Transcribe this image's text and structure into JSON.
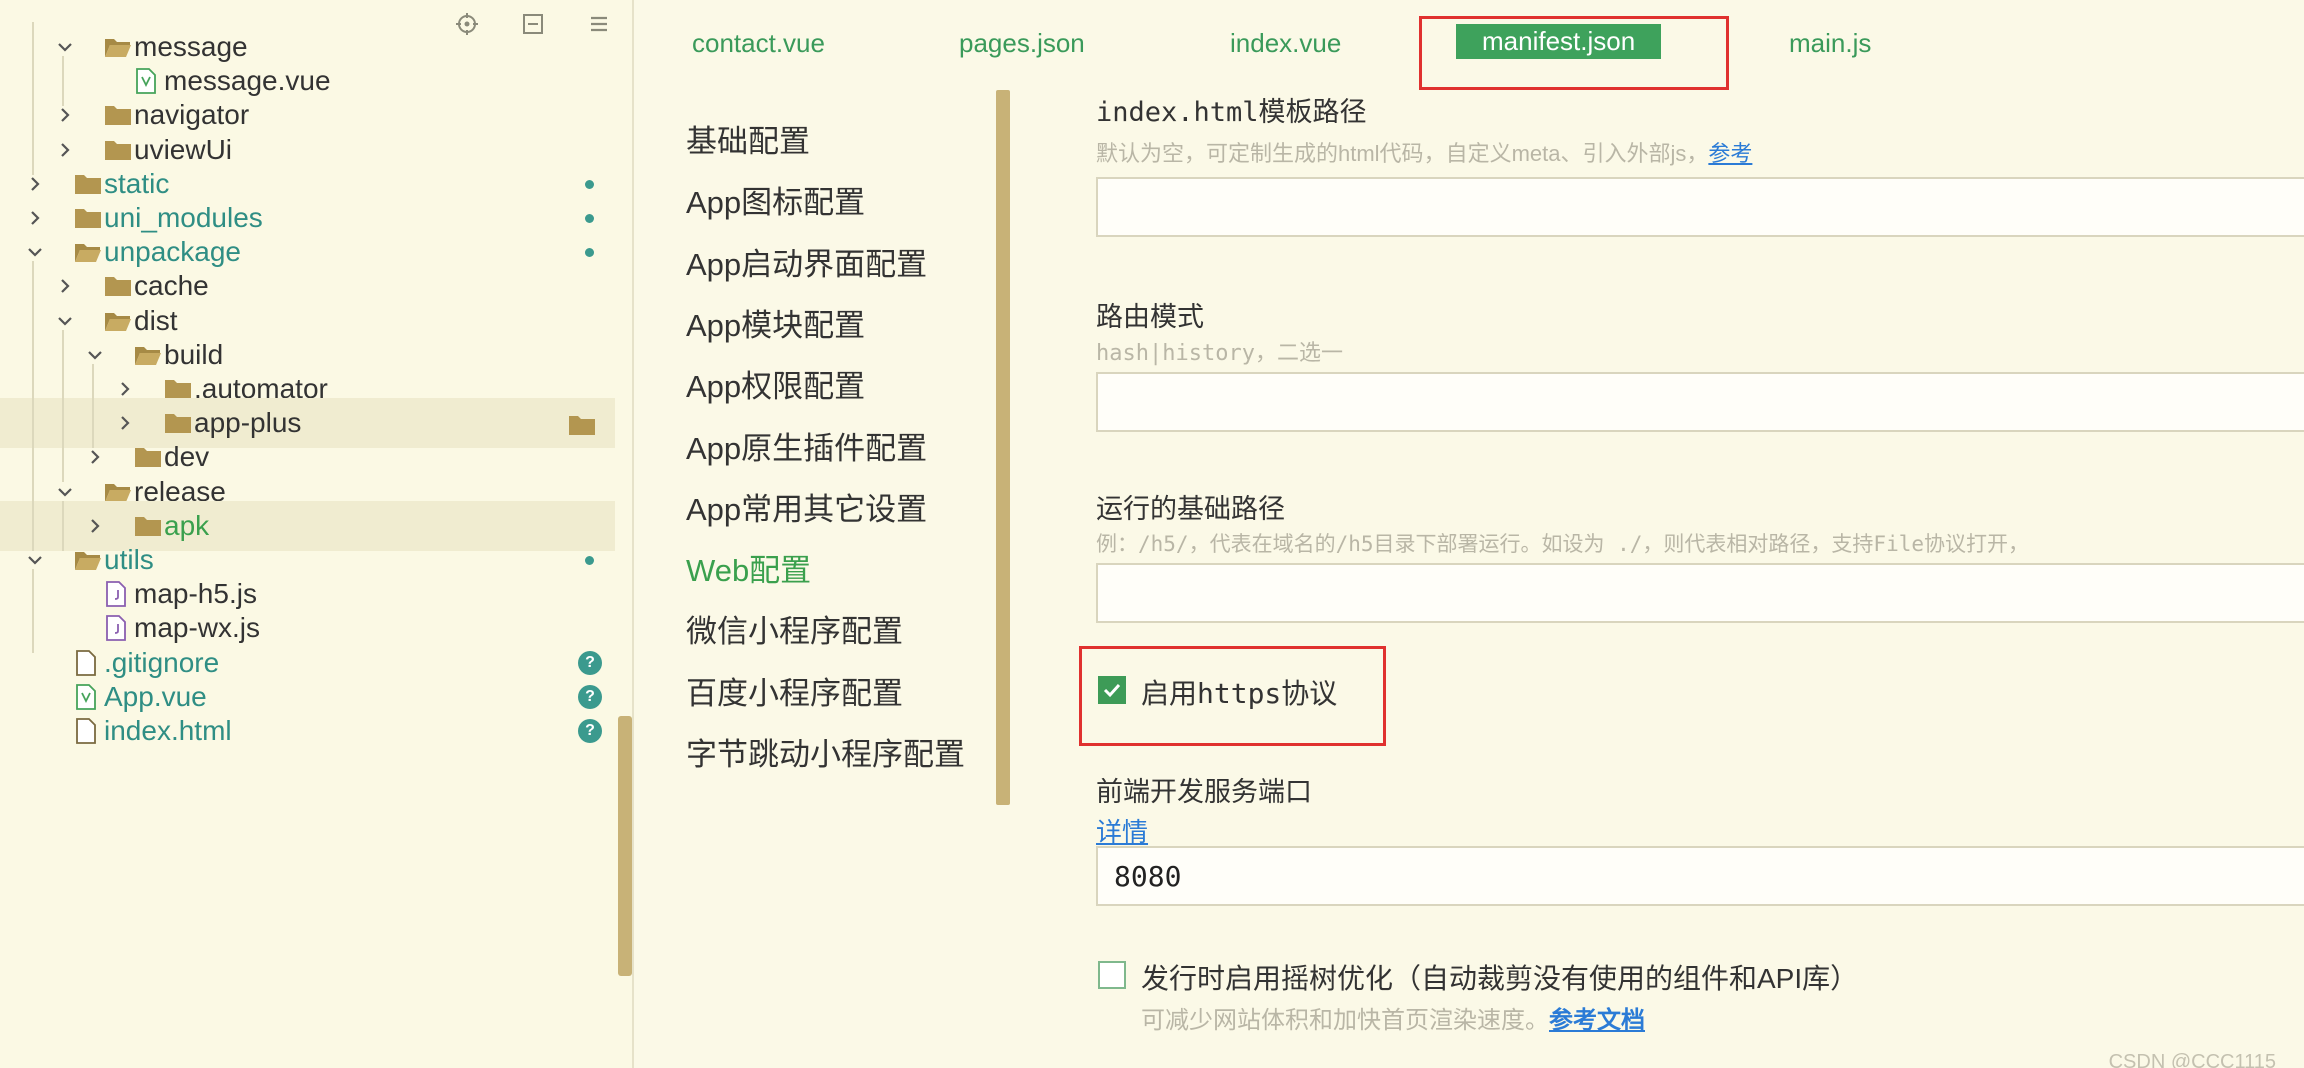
{
  "explorer": {
    "toolbar": [
      "locate-icon",
      "collapse-icon",
      "menu-icon"
    ],
    "tree": [
      {
        "label": "message",
        "depth": 1,
        "type": "folder",
        "expanded": true
      },
      {
        "label": "message.vue",
        "depth": 2,
        "type": "vue"
      },
      {
        "label": "navigator",
        "depth": 1,
        "type": "folder",
        "expanded": false
      },
      {
        "label": "uviewUi",
        "depth": 1,
        "type": "folder",
        "expanded": false
      },
      {
        "label": "static",
        "depth": 0,
        "type": "folder",
        "expanded": false,
        "color": "teal",
        "badge": "dot"
      },
      {
        "label": "uni_modules",
        "depth": 0,
        "type": "folder",
        "expanded": false,
        "color": "teal",
        "badge": "dot"
      },
      {
        "label": "unpackage",
        "depth": 0,
        "type": "folder",
        "expanded": true,
        "color": "teal",
        "badge": "dot"
      },
      {
        "label": "cache",
        "depth": 1,
        "type": "folder",
        "expanded": false
      },
      {
        "label": "dist",
        "depth": 1,
        "type": "folder",
        "expanded": true
      },
      {
        "label": "build",
        "depth": 2,
        "type": "folder",
        "expanded": true
      },
      {
        "label": ".automator",
        "depth": 3,
        "type": "folder",
        "expanded": false
      },
      {
        "label": "app-plus",
        "depth": 3,
        "type": "folder",
        "expanded": false,
        "selected": true,
        "trailing_icon": true
      },
      {
        "label": "dev",
        "depth": 2,
        "type": "folder",
        "expanded": false
      },
      {
        "label": "release",
        "depth": 1,
        "type": "folder",
        "expanded": true
      },
      {
        "label": "apk",
        "depth": 2,
        "type": "folder",
        "expanded": false,
        "color": "green",
        "selected": true
      },
      {
        "label": "utils",
        "depth": 0,
        "type": "folder",
        "expanded": true,
        "color": "teal",
        "badge": "dot"
      },
      {
        "label": "map-h5.js",
        "depth": 1,
        "type": "js"
      },
      {
        "label": "map-wx.js",
        "depth": 1,
        "type": "js"
      },
      {
        "label": ".gitignore",
        "depth": 0,
        "type": "file",
        "color": "teal",
        "badge": "?"
      },
      {
        "label": "App.vue",
        "depth": 0,
        "type": "vue",
        "color": "teal",
        "badge": "?"
      },
      {
        "label": "index.html",
        "depth": 0,
        "type": "file",
        "color": "teal",
        "badge": "?"
      }
    ]
  },
  "tabs": [
    {
      "label": "contact.vue",
      "active": false
    },
    {
      "label": "pages.json",
      "active": false
    },
    {
      "label": "index.vue",
      "active": false
    },
    {
      "label": "manifest.json",
      "active": true
    },
    {
      "label": "main.js",
      "active": false
    }
  ],
  "settings_nav": [
    {
      "label": "基础配置"
    },
    {
      "label": "App图标配置"
    },
    {
      "label": "App启动界面配置"
    },
    {
      "label": "App模块配置"
    },
    {
      "label": "App权限配置"
    },
    {
      "label": "App原生插件配置"
    },
    {
      "label": "App常用其它设置"
    },
    {
      "label": "Web配置",
      "active": true
    },
    {
      "label": "微信小程序配置"
    },
    {
      "label": "百度小程序配置"
    },
    {
      "label": "字节跳动小程序配置"
    }
  ],
  "content": {
    "template": {
      "title": "index.html模板路径",
      "desc": "默认为空，可定制生成的html代码，自定义meta、引入外部js，",
      "link": "参考",
      "value": ""
    },
    "router": {
      "title": "路由模式",
      "desc": "hash|history，二选一",
      "value": ""
    },
    "base": {
      "title": "运行的基础路径",
      "desc": "例：/h5/，代表在域名的/h5目录下部署运行。如设为 ./，则代表相对路径，支持File协议打开，",
      "value": ""
    },
    "https": {
      "label": "启用https协议",
      "checked": true
    },
    "port": {
      "title": "前端开发服务端口",
      "link": "详情",
      "value": "8080"
    },
    "treeshake": {
      "label": "发行时启用摇树优化（自动裁剪没有使用的组件和API库）",
      "checked": false,
      "desc": "可减少网站体积和加快首页渲染速度。",
      "link": "参考文档"
    }
  },
  "watermark": "CSDN @CCC1115",
  "colors": {
    "accent": "#3ea25c",
    "teal": "#2f8e84",
    "highlight": "#e0312f",
    "scroll": "#c8b277"
  }
}
